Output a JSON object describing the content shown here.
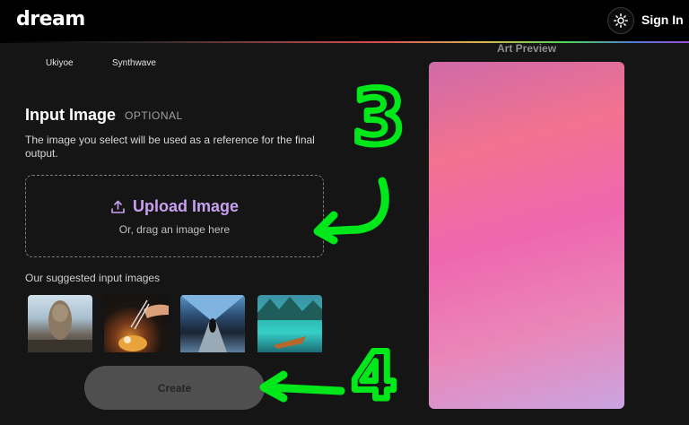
{
  "header": {
    "logo": "dream",
    "sign_in": "Sign In"
  },
  "styles": {
    "item_a": "Ukiyoe",
    "item_b": "Synthwave"
  },
  "preview": {
    "label": "Art Preview"
  },
  "input_image": {
    "title": "Input Image",
    "optional": "OPTIONAL",
    "description": "The image you select will be used as a reference for the final output.",
    "upload_label": "Upload Image",
    "drag_hint": "Or, drag an image here",
    "suggested_title": "Our suggested input images"
  },
  "create": {
    "label": "Create"
  },
  "annotations": {
    "step_3": "3",
    "step_4": "4"
  },
  "colors": {
    "accent": "#c8a0f0",
    "annotation": "#00e81a",
    "preview_pink": "#ee67b0"
  },
  "icons": {
    "theme": "sun-icon",
    "upload": "upload-icon"
  }
}
